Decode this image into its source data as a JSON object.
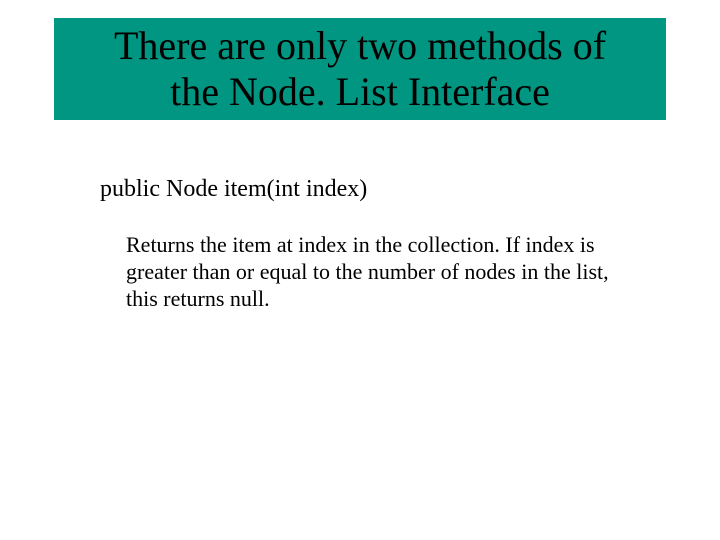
{
  "title": {
    "line1": "There are only two methods of",
    "line2": "the Node. List Interface"
  },
  "method": {
    "signature": "public Node item(int index)",
    "description": "Returns the item at index in the collection. If index is greater than or equal to the number of nodes in the list, this returns null."
  }
}
